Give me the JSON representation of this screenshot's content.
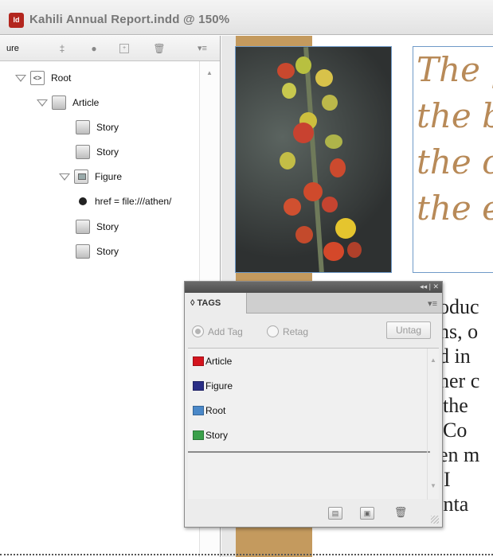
{
  "window": {
    "title": "Kahili Annual Report.indd @ 150%",
    "app_icon_label": "Id"
  },
  "structure_pane": {
    "tab_label": "ure",
    "toolbar_icons": [
      "attribute-icon",
      "bullet-icon",
      "new-element-icon",
      "trash-icon",
      "panel-menu-icon"
    ],
    "tree": [
      {
        "label": "Root",
        "type": "root",
        "expanded": true,
        "level": 0
      },
      {
        "label": "Article",
        "type": "element",
        "expanded": true,
        "level": 1
      },
      {
        "label": "Story",
        "type": "element",
        "level": 2
      },
      {
        "label": "Story",
        "type": "element",
        "level": 2
      },
      {
        "label": "Figure",
        "type": "figure",
        "expanded": true,
        "level": 2
      },
      {
        "label": "href = file:///athen/",
        "type": "attribute",
        "level": 3
      },
      {
        "label": "Story",
        "type": "element",
        "level": 2
      },
      {
        "label": "Story",
        "type": "element",
        "level": 2
      }
    ]
  },
  "document": {
    "headline_lines": [
      "The p",
      "the b",
      "the c",
      "the e"
    ],
    "headline_color": "#b88a58",
    "body_lines": [
      "oduc",
      "ns, o",
      "d in",
      "her c",
      "the",
      "Co",
      "en m",
      "the site of I",
      "Coffee planta"
    ],
    "strip_color": "#c49a5e"
  },
  "tags_panel": {
    "tab_label": "◊ TAGS",
    "add_tag_label": "Add Tag",
    "retag_label": "Retag",
    "untag_label": "Untag",
    "tags": [
      {
        "name": "Article",
        "color": "#d4141e"
      },
      {
        "name": "Figure",
        "color": "#2a2e86"
      },
      {
        "name": "Root",
        "color": "#4a88c8"
      },
      {
        "name": "Story",
        "color": "#3aa04a"
      }
    ],
    "footer_icons": [
      "tag-frame-icon",
      "new-tag-icon",
      "delete-tag-icon"
    ]
  }
}
